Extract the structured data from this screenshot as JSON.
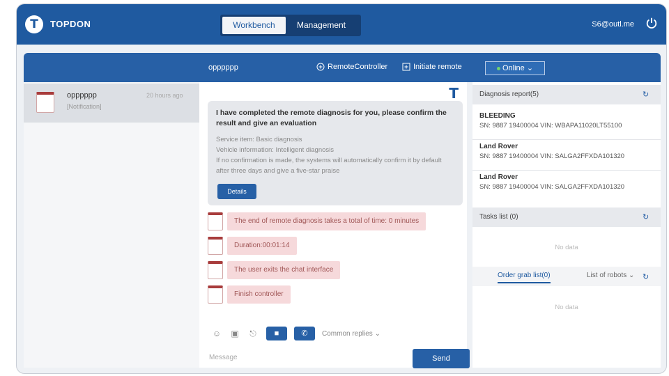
{
  "header": {
    "brand": "TOPDON",
    "tabs": [
      {
        "label": "Workbench",
        "active": true
      },
      {
        "label": "Management",
        "active": false
      }
    ],
    "user": "S6@outl.me"
  },
  "subbar": {
    "conversation_title": "opppppp",
    "remote_controller_label": "RemoteController",
    "initiate_remote_label": "Initiate remote",
    "status_label": "Online"
  },
  "conversations": [
    {
      "name": "opppppp",
      "subtitle": "[Notification]",
      "time": "20 hours ago"
    }
  ],
  "chat": {
    "card": {
      "title": "I have completed the remote diagnosis for you, please confirm the result and give an evaluation",
      "service_item": "Service item:  Basic diagnosis",
      "vehicle_info": "Vehicle information:  Intelligent diagnosis",
      "note": "If no confirmation is made, the systems will automatically confirm it by default after three days and give a five-star praise",
      "details_label": "Details"
    },
    "messages": [
      "The end of remote diagnosis takes a total of time: 0 minutes",
      "Duration:00:01:14",
      "The user exits the chat interface",
      "Finish controller"
    ],
    "common_replies": "Common replies",
    "message_placeholder": "Message",
    "send_label": "Send"
  },
  "right_panel": {
    "diagnosis_title": "Diagnosis report(5)",
    "reports": [
      {
        "name": "BLEEDING",
        "sn": "SN: 9887 19400004    VIN: WBAPA11020LT55100"
      },
      {
        "name": "Land Rover",
        "sn": "SN: 9887 19400004    VIN: SALGA2FFXDA101320"
      },
      {
        "name": "Land Rover",
        "sn": "SN: 9887 19400004    VIN: SALGA2FFXDA101320"
      }
    ],
    "tasks_title": "Tasks list (0)",
    "tasks_empty": "No data",
    "order_tab": "Order grab list(0)",
    "robots_tab": "List of robots",
    "order_empty": "No data"
  },
  "colors": {
    "primary": "#1f5aa0",
    "bubble": "#f6d9db",
    "online_dot": "#6fd36f"
  }
}
